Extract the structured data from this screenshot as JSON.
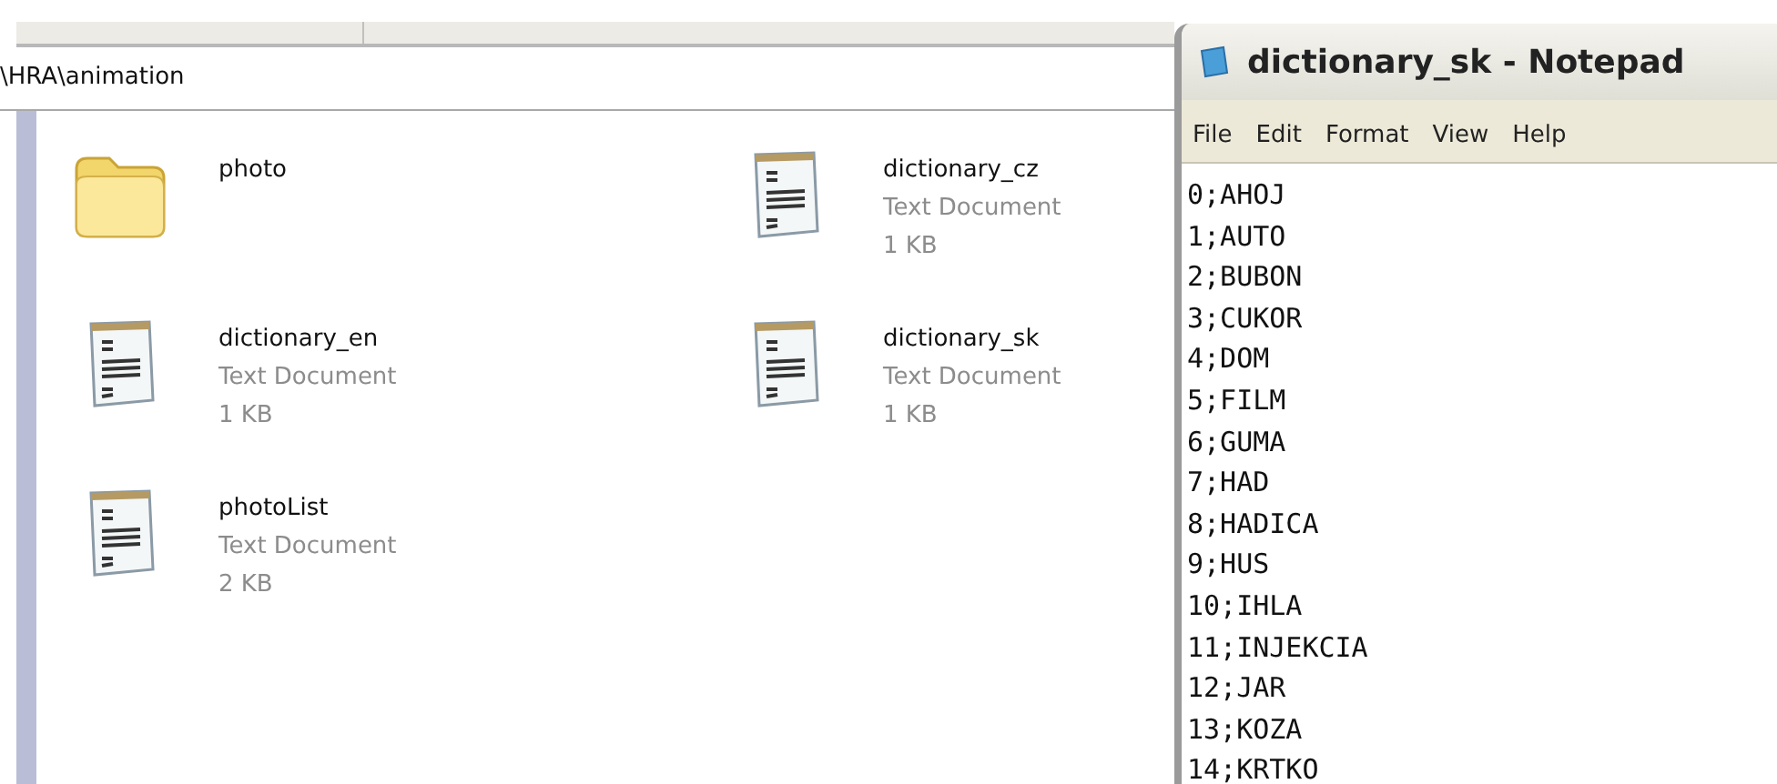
{
  "explorer": {
    "address": "\\HRA\\animation",
    "items": [
      {
        "kind": "folder",
        "name": "photo"
      },
      {
        "kind": "text",
        "name": "dictionary_cz",
        "type": "Text Document",
        "size": "1 KB"
      },
      {
        "kind": "text",
        "name": "dictionary_en",
        "type": "Text Document",
        "size": "1 KB"
      },
      {
        "kind": "text",
        "name": "dictionary_sk",
        "type": "Text Document",
        "size": "1 KB"
      },
      {
        "kind": "text",
        "name": "photoList",
        "type": "Text Document",
        "size": "2 KB"
      }
    ]
  },
  "notepad": {
    "title": "dictionary_sk - Notepad",
    "menu": [
      "File",
      "Edit",
      "Format",
      "View",
      "Help"
    ],
    "lines": [
      "0;AHOJ",
      "1;AUTO",
      "2;BUBON",
      "3;CUKOR",
      "4;DOM",
      "5;FILM",
      "6;GUMA",
      "7;HAD",
      "8;HADICA",
      "9;HUS",
      "10;IHLA",
      "11;INJEKCIA",
      "12;JAR",
      "13;KOZA",
      "14;KRTKO"
    ]
  }
}
